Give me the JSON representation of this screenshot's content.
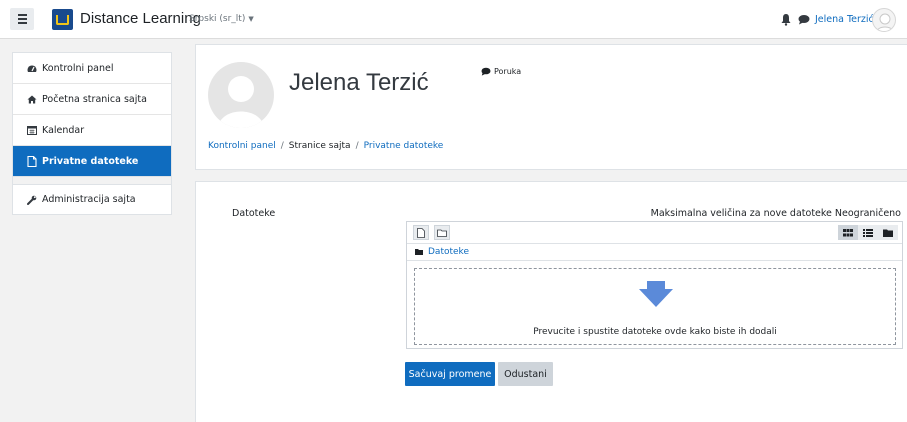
{
  "navbar": {
    "site_name": "Distance Learning",
    "language": "Srpski (sr_lt)",
    "user_name": "Jelena Terzić"
  },
  "sidebar": {
    "items": [
      {
        "label": "Kontrolni panel",
        "icon": "dashboard-icon"
      },
      {
        "label": "Početna stranica sajta",
        "icon": "home-icon"
      },
      {
        "label": "Kalendar",
        "icon": "calendar-icon"
      },
      {
        "label": "Privatne datoteke",
        "icon": "file-icon",
        "active": true
      },
      {
        "label": "Administracija sajta",
        "icon": "wrench-icon"
      }
    ]
  },
  "header": {
    "title": "Jelena Terzić",
    "message_label": "Poruka",
    "breadcrumb": [
      "Kontrolni panel",
      "Stranice sajta",
      "Privatne datoteke"
    ]
  },
  "main": {
    "field_label": "Datoteke",
    "max_size_text": "Maksimalna veličina za nove datoteke Neograničeno",
    "fm_path_label": "Datoteke",
    "dropzone_text": "Prevucite i spustite datoteke ovde kako biste ih dodali",
    "save_label": "Sačuvaj promene",
    "cancel_label": "Odustani"
  },
  "colors": {
    "primary": "#0f6cbf",
    "drop_arrow": "#5b8ad9"
  }
}
